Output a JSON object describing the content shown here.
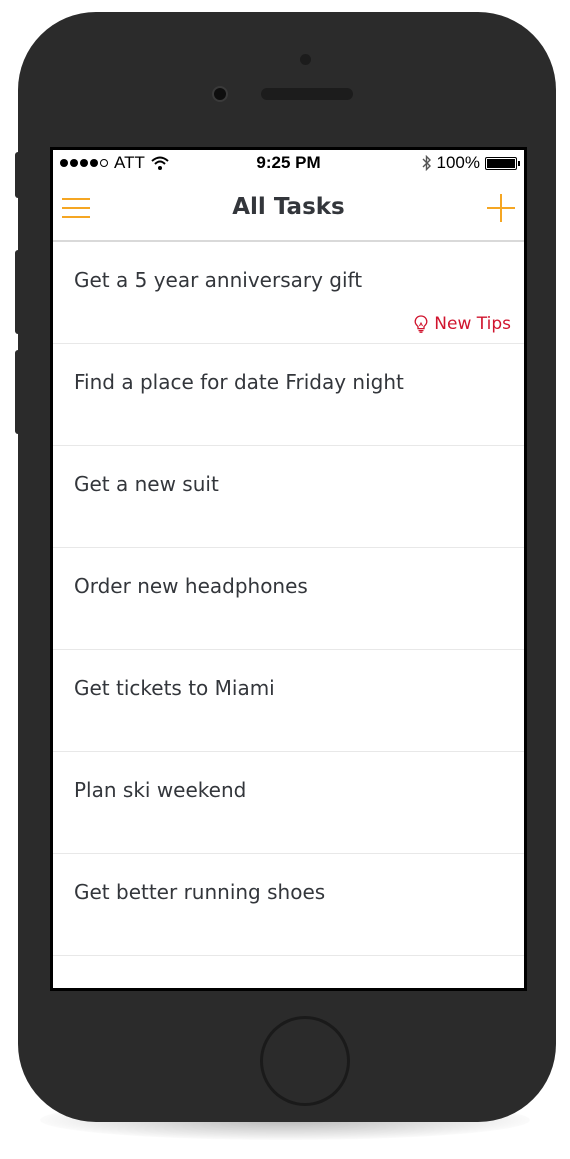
{
  "status_bar": {
    "carrier": "ATT",
    "time": "9:25 PM",
    "battery": "100%",
    "battery_level": 1.0,
    "signal_icon": "signal-dots-icon",
    "wifi_icon": "wifi-icon",
    "bluetooth_icon": "bluetooth-icon"
  },
  "nav": {
    "title": "All Tasks",
    "menu_icon": "hamburger-menu-icon",
    "add_icon": "plus-icon"
  },
  "tasks": [
    {
      "label": "Get a 5 year anniversary gift",
      "tip": "New Tips"
    },
    {
      "label": "Find a place for date Friday night"
    },
    {
      "label": "Get a new suit"
    },
    {
      "label": "Order new headphones"
    },
    {
      "label": "Get tickets to Miami"
    },
    {
      "label": "Plan ski weekend"
    },
    {
      "label": "Get better running shoes"
    }
  ],
  "colors": {
    "accent": "#f5a623",
    "tip": "#d0142e",
    "text": "#33363b",
    "phone_body": "#2b2b2b"
  }
}
